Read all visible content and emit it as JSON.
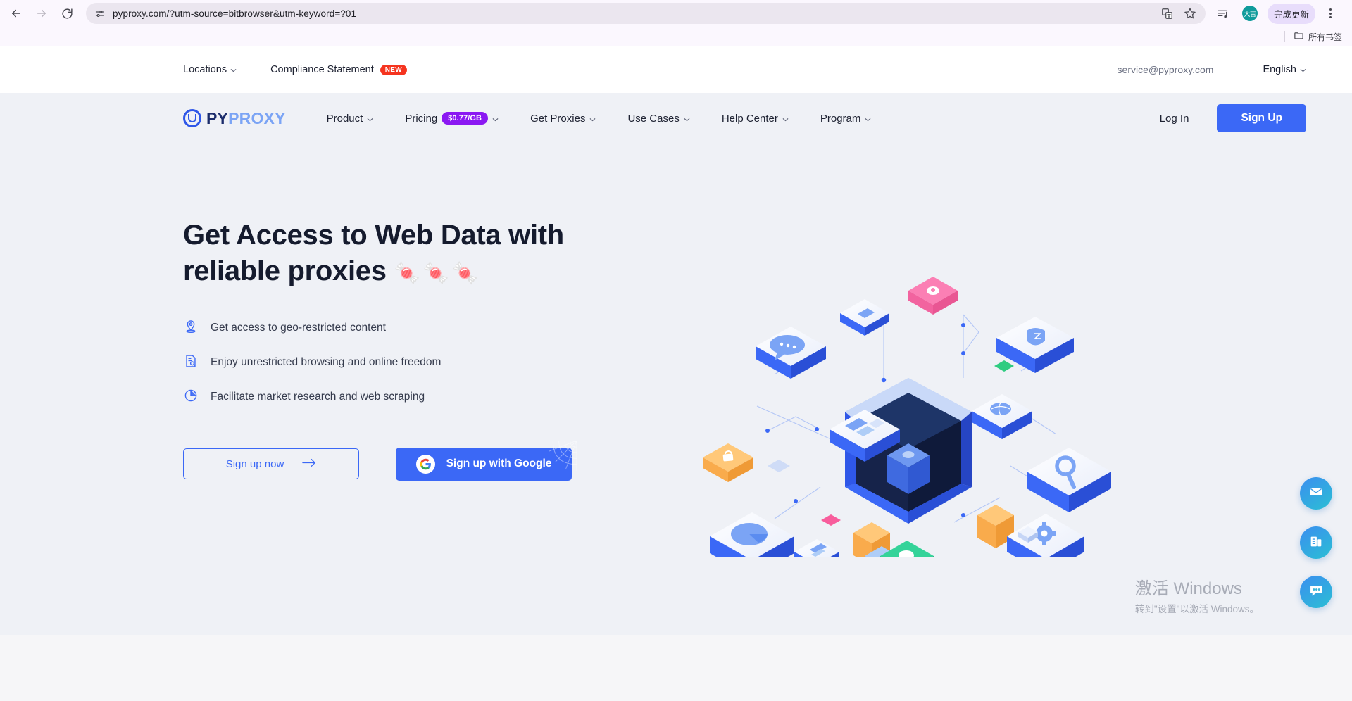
{
  "browser": {
    "url": "pyproxy.com/?utm-source=bitbrowser&utm-keyword=?01",
    "back_icon": "back-arrow-icon",
    "forward_icon": "forward-arrow-icon",
    "reload_icon": "reload-icon",
    "site_settings_icon": "tune-icon",
    "translate_icon": "translate-icon",
    "bookmark_icon": "star-icon",
    "reading_list_icon": "reading-list-icon",
    "profile_initials": "大吉",
    "update_label": "完成更新",
    "menu_icon": "three-dot-menu-icon",
    "bookmarks_label": "所有书签",
    "bookmarks_folder_icon": "folder-icon"
  },
  "topbar": {
    "locations": "Locations",
    "compliance": "Compliance Statement",
    "compliance_badge": "NEW",
    "email": "service@pyproxy.com",
    "language": "English"
  },
  "nav": {
    "logo_py": "PY",
    "logo_proxy": "PROXY",
    "links": [
      {
        "label": "Product"
      },
      {
        "label": "Pricing",
        "badge": "$0.77/GB"
      },
      {
        "label": "Get Proxies"
      },
      {
        "label": "Use Cases"
      },
      {
        "label": "Help Center"
      },
      {
        "label": "Program"
      }
    ],
    "login": "Log In",
    "signup": "Sign Up"
  },
  "hero": {
    "title_line1": "Get Access to Web Data with",
    "title_line2": "reliable proxies",
    "title_emoji": "🍬🍬🍬",
    "features": [
      {
        "icon": "location-pin-icon",
        "text": "Get access to geo-restricted content"
      },
      {
        "icon": "document-search-icon",
        "text": "Enjoy unrestricted browsing and online freedom"
      },
      {
        "icon": "pie-chart-icon",
        "text": "Facilitate market research and web scraping"
      }
    ],
    "cta_primary": "Sign up now",
    "cta_arrow": "→",
    "cta_google": "Sign up with Google"
  },
  "fabs": [
    {
      "icon": "envelope-icon",
      "name": "contact-email-fab"
    },
    {
      "icon": "enterprise-icon",
      "name": "enterprise-fab"
    },
    {
      "icon": "chat-bubble-icon",
      "name": "live-chat-fab"
    }
  ],
  "watermark": {
    "line1": "激活 Windows",
    "line2": "转到\"设置\"以激活 Windows。"
  },
  "colors": {
    "brand_blue": "#3b68f6",
    "logo_dark": "#1b2c6b",
    "logo_light": "#7ba4f5",
    "price_purple": "#8b18f2",
    "badge_red": "#f5341f",
    "hero_bg": "#eff1f6"
  }
}
